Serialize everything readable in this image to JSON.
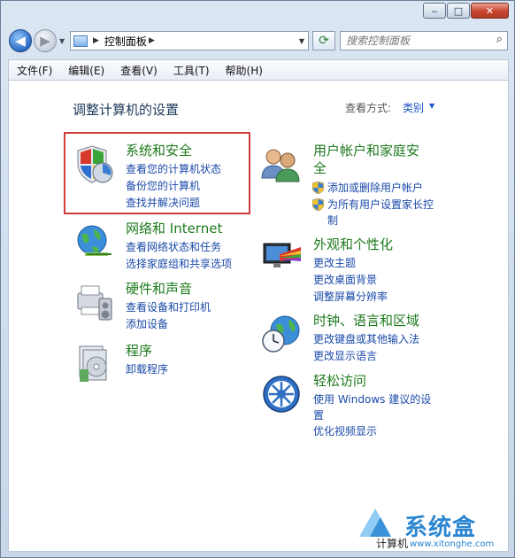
{
  "window": {
    "minimize_label": "‒",
    "maximize_label": "□",
    "close_label": "✕"
  },
  "nav": {
    "back_icon": "◀",
    "forward_icon": "▶",
    "address_text": "控制面板",
    "address_arrow": "▶",
    "dropdown_arrow": "▼",
    "refresh_icon": "⟳",
    "search_placeholder": "搜索控制面板",
    "search_icon": "⌕"
  },
  "menu": {
    "items": [
      "文件(F)",
      "编辑(E)",
      "查看(V)",
      "工具(T)",
      "帮助(H)"
    ]
  },
  "page": {
    "title": "调整计算机的设置",
    "view_by_label": "查看方式:",
    "view_by_value": "类别",
    "view_by_arrow": "▼"
  },
  "categories": {
    "system": {
      "title": "系统和安全",
      "links": [
        "查看您的计算机状态",
        "备份您的计算机",
        "查找并解决问题"
      ]
    },
    "network": {
      "title": "网络和 Internet",
      "links": [
        "查看网络状态和任务",
        "选择家庭组和共享选项"
      ]
    },
    "hardware": {
      "title": "硬件和声音",
      "links": [
        "查看设备和打印机",
        "添加设备"
      ]
    },
    "programs": {
      "title": "程序",
      "links": [
        "卸载程序"
      ]
    },
    "users": {
      "title_line1": "用户帐户和家庭安",
      "title_line2": "全",
      "links": [
        "添加或删除用户帐户",
        "为所有用户设置家长控",
        "制"
      ]
    },
    "appearance": {
      "title": "外观和个性化",
      "links": [
        "更改主题",
        "更改桌面背景",
        "调整屏幕分辨率"
      ]
    },
    "clock": {
      "title": "时钟、语言和区域",
      "links": [
        "更改键盘或其他输入法",
        "更改显示语言"
      ]
    },
    "access": {
      "title": "轻松访问",
      "links": [
        "使用 Windows 建议的设",
        "置",
        "优化视频显示"
      ]
    }
  },
  "watermark": {
    "text": "系统盒",
    "url": "www.xitonghe.com"
  },
  "status_text": "计算机",
  "colors": {
    "category_title": "#1d7a1d",
    "link": "#1a49a8",
    "highlight_box": "#d23b3b"
  }
}
